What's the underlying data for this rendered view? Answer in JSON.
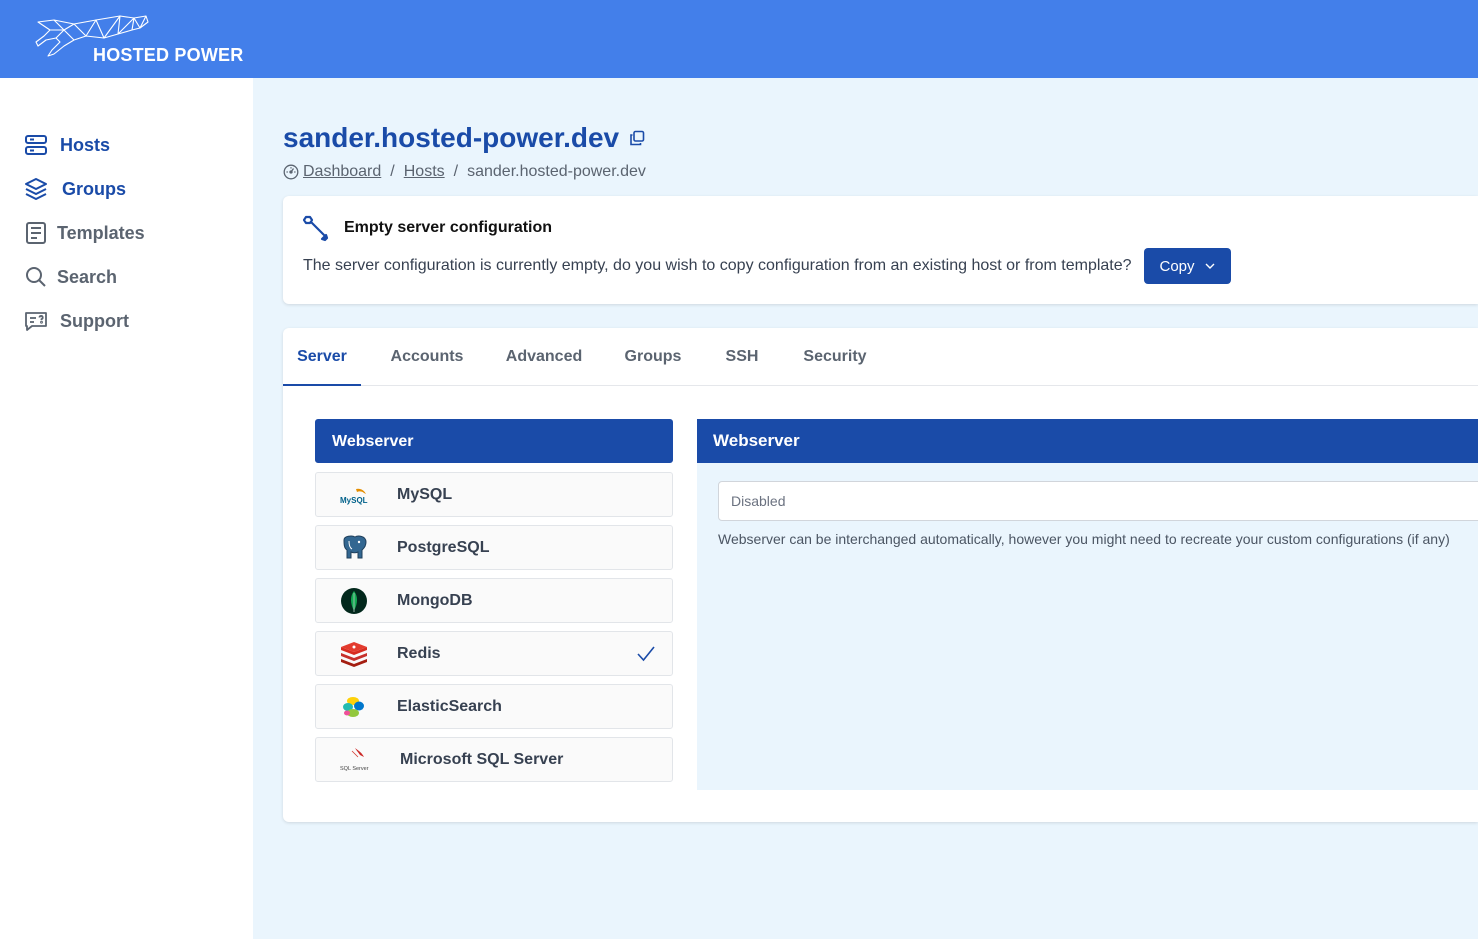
{
  "brand": {
    "name": "HOSTED POWER",
    "accent": "#437fea",
    "primary": "#1a4ba8"
  },
  "sidebar": {
    "items": [
      {
        "label": "Hosts",
        "icon": "server-icon",
        "active": true
      },
      {
        "label": "Groups",
        "icon": "layers-icon",
        "active": true
      },
      {
        "label": "Templates",
        "icon": "document-icon",
        "active": false
      },
      {
        "label": "Search",
        "icon": "search-icon",
        "active": false
      },
      {
        "label": "Support",
        "icon": "chat-icon",
        "active": false
      }
    ]
  },
  "page": {
    "title": "sander.hosted-power.dev",
    "breadcrumb": [
      "Dashboard",
      "Hosts",
      "sander.hosted-power.dev"
    ]
  },
  "notice": {
    "title": "Empty server configuration",
    "text": "The server configuration is currently empty, do you wish to copy configuration from an existing host or from template?",
    "button_label": "Copy"
  },
  "tabs": [
    {
      "label": "Server",
      "active": true
    },
    {
      "label": "Accounts",
      "active": false
    },
    {
      "label": "Advanced",
      "active": false
    },
    {
      "label": "Groups",
      "active": false
    },
    {
      "label": "SSH",
      "active": false
    },
    {
      "label": "Security",
      "active": false
    }
  ],
  "services": [
    {
      "label": "Webserver",
      "active": true,
      "checked": false
    },
    {
      "label": "MySQL",
      "active": false,
      "checked": false,
      "logo": "mysql-logo-icon",
      "logo_text": "MySQL"
    },
    {
      "label": "PostgreSQL",
      "active": false,
      "checked": false,
      "logo": "postgresql-elephant-icon"
    },
    {
      "label": "MongoDB",
      "active": false,
      "checked": false,
      "logo": "mongodb-leaf-icon"
    },
    {
      "label": "Redis",
      "active": false,
      "checked": true,
      "logo": "redis-cube-icon"
    },
    {
      "label": "ElasticSearch",
      "active": false,
      "checked": false,
      "logo": "elasticsearch-icon"
    },
    {
      "label": "Microsoft SQL Server",
      "active": false,
      "checked": false,
      "logo": "sql-server-icon",
      "logo_text": "SQL Server"
    }
  ],
  "detail": {
    "title": "Webserver",
    "select_value": "Disabled",
    "help": "Webserver can be interchanged automatically, however you might need to recreate your custom configurations (if any)"
  }
}
